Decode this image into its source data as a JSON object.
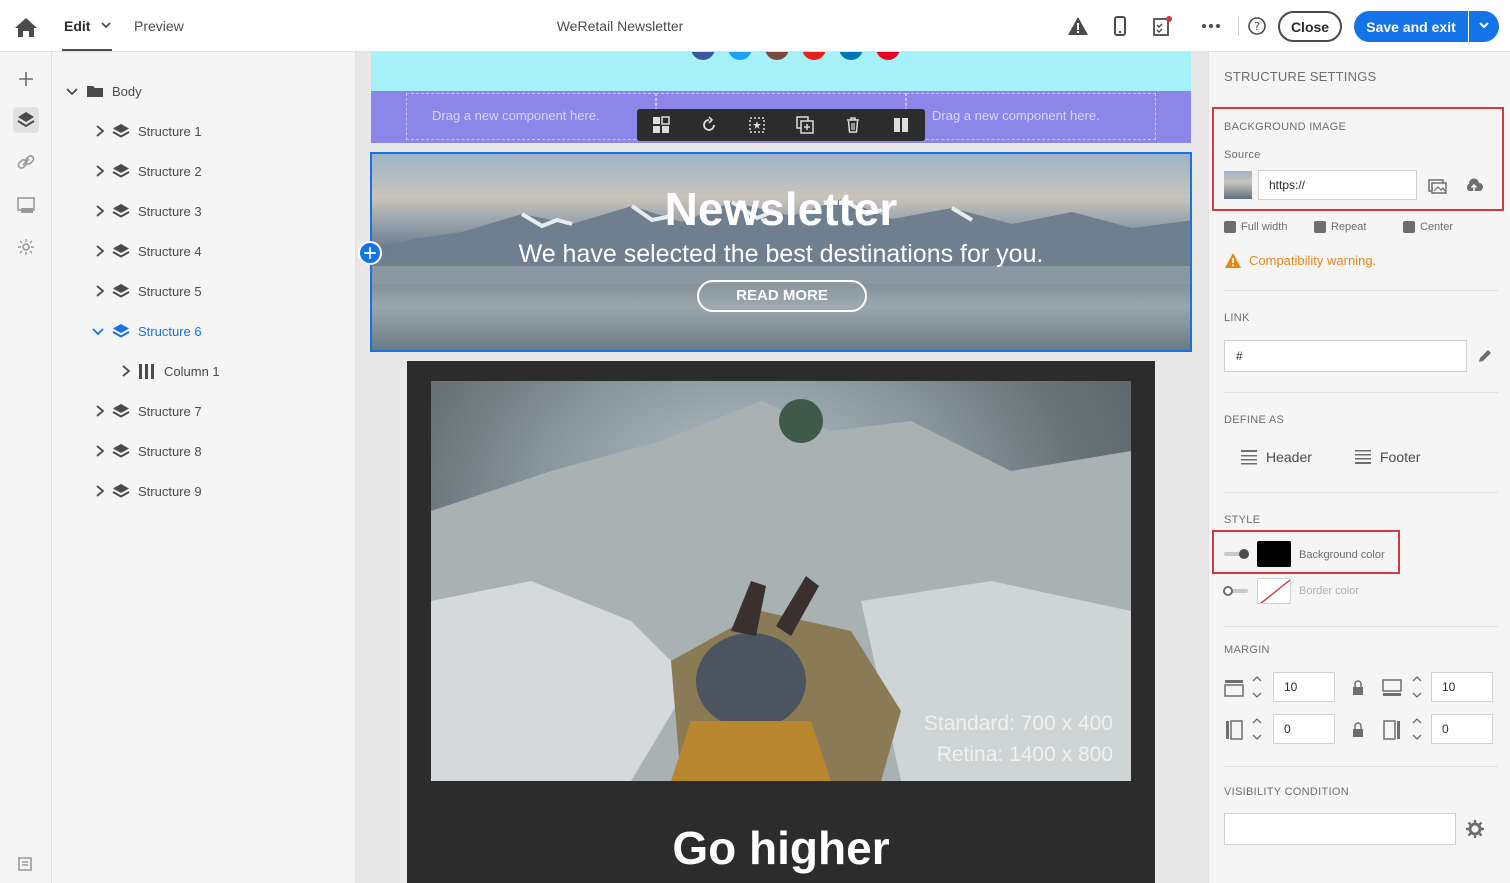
{
  "header": {
    "tab_edit": "Edit",
    "tab_preview": "Preview",
    "title": "WeRetail Newsletter",
    "close_label": "Close",
    "save_label": "Save and exit"
  },
  "tree": {
    "root": "Body",
    "items": [
      {
        "label": "Structure 1"
      },
      {
        "label": "Structure 2"
      },
      {
        "label": "Structure 3"
      },
      {
        "label": "Structure 4"
      },
      {
        "label": "Structure 5"
      },
      {
        "label": "Structure 6",
        "selected": true
      },
      {
        "label": "Column 1",
        "child": true
      },
      {
        "label": "Structure 7"
      },
      {
        "label": "Structure 8"
      },
      {
        "label": "Structure 9"
      }
    ]
  },
  "canvas": {
    "drop_left": "Drag a new component here.",
    "drop_right": "Drag a new component here.",
    "hero_title": "Newsletter",
    "hero_subtitle": "We have selected the best destinations for you.",
    "hero_button": "READ MORE",
    "photo_caption_1": "Standard: 700 x 400",
    "photo_caption_2": "Retina: 1400 x 800",
    "section_title": "Go higher"
  },
  "settings": {
    "title": "STRUCTURE SETTINGS",
    "bg_image_head": "BACKGROUND IMAGE",
    "source_label": "Source",
    "source_value": "https://",
    "full_width": "Full width",
    "repeat": "Repeat",
    "center": "Center",
    "warning": "Compatibility warning.",
    "link_head": "LINK",
    "link_value": "#",
    "define_head": "DEFINE AS",
    "header_btn": "Header",
    "footer_btn": "Footer",
    "style_head": "STYLE",
    "bg_color_label": "Background color",
    "border_color_label": "Border color",
    "margin_head": "MARGIN",
    "margin_top": "10",
    "margin_bottom": "10",
    "margin_left": "0",
    "margin_right": "0",
    "visibility_head": "VISIBILITY CONDITION"
  },
  "colors": {
    "accent": "#1473e6",
    "highlight": "#d7373f",
    "warning": "#e68619",
    "background_color_value": "#000000"
  }
}
